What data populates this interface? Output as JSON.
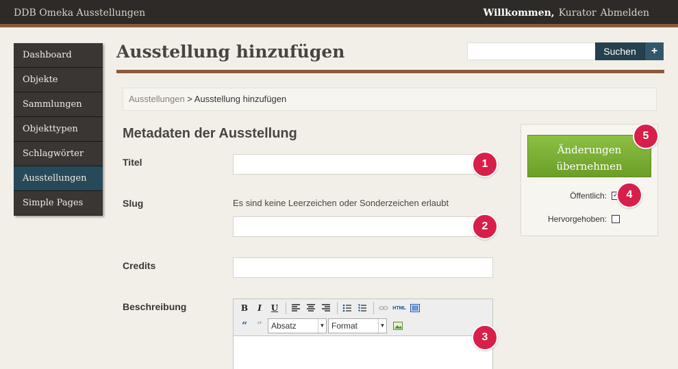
{
  "header": {
    "site_title": "DDB Omeka Ausstellungen",
    "welcome": "Willkommen,",
    "user": "Kurator",
    "logout": "Abmelden"
  },
  "sidebar": {
    "items": [
      {
        "label": "Dashboard"
      },
      {
        "label": "Objekte"
      },
      {
        "label": "Sammlungen"
      },
      {
        "label": "Objekttypen"
      },
      {
        "label": "Schlagwörter"
      },
      {
        "label": "Ausstellungen",
        "active": true
      },
      {
        "label": "Simple Pages"
      }
    ]
  },
  "page": {
    "title": "Ausstellung hinzufügen",
    "search_value": "",
    "search_button": "Suchen",
    "advanced_button": "+"
  },
  "breadcrumb": {
    "link": "Ausstellungen",
    "separator": " > ",
    "current": "Ausstellung hinzufügen"
  },
  "form": {
    "section_title": "Metadaten der Ausstellung",
    "title_label": "Titel",
    "title_value": "",
    "slug_label": "Slug",
    "slug_hint": "Es sind keine Leerzeichen oder Sonderzeichen erlaubt",
    "slug_value": "",
    "credits_label": "Credits",
    "credits_value": "",
    "description_label": "Beschreibung",
    "editor": {
      "bold": "B",
      "italic": "I",
      "underline": "U",
      "html": "HTML",
      "block_select": "Absatz",
      "format_select": "Format"
    }
  },
  "save_panel": {
    "save_line1": "Änderungen",
    "save_line2": "übernehmen",
    "public_label": "Öffentlich:",
    "public_checked": true,
    "featured_label": "Hervorgehoben:",
    "featured_checked": false
  },
  "markers": [
    "1",
    "2",
    "3",
    "4",
    "5"
  ],
  "colors": {
    "topbar": "#2d2a27",
    "accent_brown": "#8a5a3c",
    "active_nav": "#274a5a",
    "save_green": "#7aaf34",
    "marker_red": "#d81f4a"
  }
}
